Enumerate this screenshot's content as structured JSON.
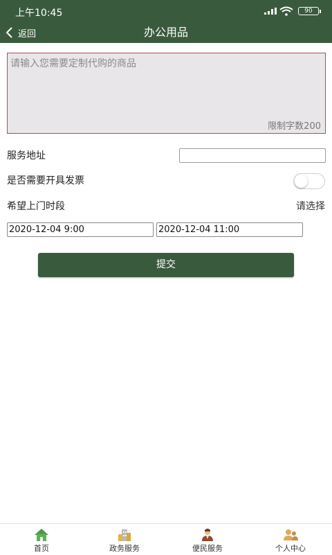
{
  "status": {
    "time": "上午10:45",
    "battery": "90"
  },
  "nav": {
    "back_label": "返回",
    "title": "办公用品"
  },
  "form": {
    "textarea_placeholder": "请输入您需要定制代购的商品",
    "char_limit": "限制字数200",
    "address_label": "服务地址",
    "address_value": "",
    "invoice_label": "是否需要开具发票",
    "invoice_enabled": false,
    "time_label": "希望上门时段",
    "time_select": "请选择",
    "start_time": "2020-12-04 9:00",
    "end_time": "2020-12-04 11:00",
    "submit_label": "提交"
  },
  "tabs": [
    {
      "label": "首页",
      "icon": "home-icon"
    },
    {
      "label": "政务服务",
      "icon": "building-icon"
    },
    {
      "label": "便民服务",
      "icon": "service-person-icon"
    },
    {
      "label": "个人中心",
      "icon": "user-group-icon"
    }
  ],
  "colors": {
    "brand": "#3a5a3d",
    "textarea_border": "#b04a5a",
    "textarea_bg": "#e9e6ea"
  }
}
